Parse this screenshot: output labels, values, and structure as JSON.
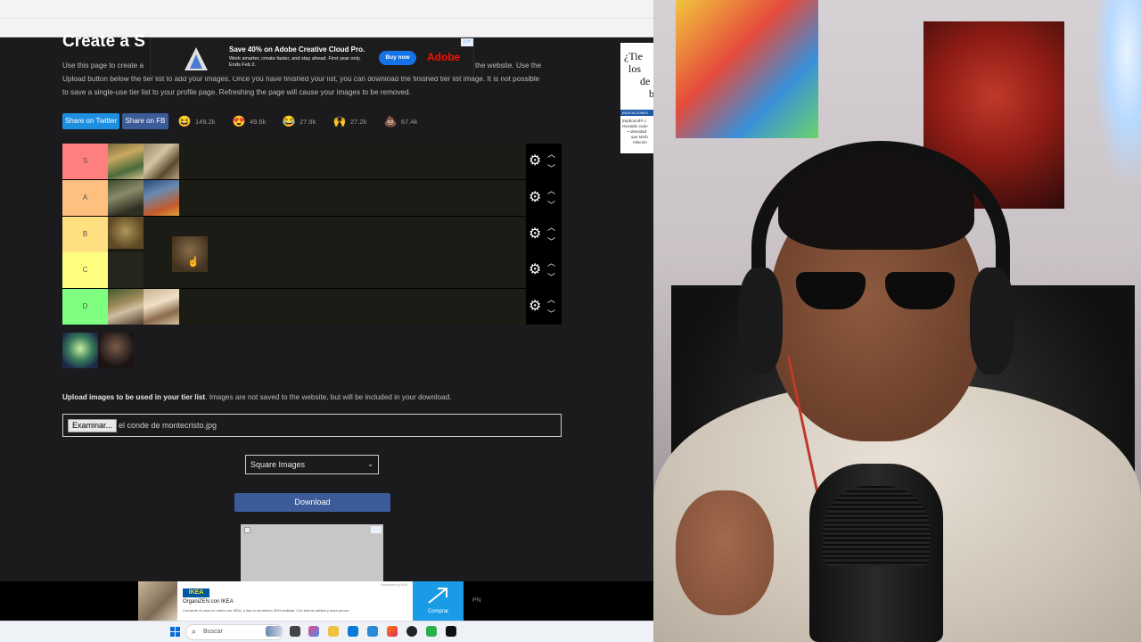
{
  "page": {
    "title": "Create a S",
    "description_lines": [
      "Use this page to create a",
      "Upload button below the tier list to add your images. Once you have finished your list, you can download the finished tier list image. It is not possible",
      "to save a single-use tier list to your profile page. Refreshing the page will cause your images to be removed."
    ],
    "description_line1_tail": "the website. Use the"
  },
  "ad_top": {
    "headline": "Save 40% on Adobe Creative Cloud Pro.",
    "sub": "Work smarter, create faster, and stay ahead. First year only. Ends Feb 2.",
    "button": "Buy now",
    "brand": "Adobe"
  },
  "ad_side": {
    "lines": [
      "¿Tie",
      "los",
      "de",
      "b"
    ],
    "band": "INDICACIONES",
    "small": [
      "Zepbound® c",
      "recetado cuan",
      "• obesidad",
      "que tamb",
      "relacion"
    ]
  },
  "share": {
    "twitter": "Share on Twitter",
    "facebook": "Share on FB"
  },
  "reactions": [
    {
      "icon": "laughing-emoji-icon",
      "glyph": "😆",
      "count": "149.2k"
    },
    {
      "icon": "heart-eyes-emoji-icon",
      "glyph": "😍",
      "count": "49.6k"
    },
    {
      "icon": "tears-of-joy-emoji-icon",
      "glyph": "😂",
      "count": "27.9k"
    },
    {
      "icon": "raised-hands-emoji-icon",
      "glyph": "🙌",
      "count": "27.2k"
    },
    {
      "icon": "poop-emoji-icon",
      "glyph": "💩",
      "count": "67.4k"
    }
  ],
  "tiers": [
    {
      "label": "S",
      "color": "#ff7f7f",
      "images": 2
    },
    {
      "label": "A",
      "color": "#ffbf7f",
      "images": 2
    },
    {
      "label": "B",
      "color": "#ffdf7f",
      "images": 1
    },
    {
      "label": "C",
      "color": "#ffff7f",
      "images": 1
    },
    {
      "label": "D",
      "color": "#7fff7f",
      "images": 2
    }
  ],
  "upload": {
    "bold": "Upload images to be used in your tier list",
    "rest": ". Images are not saved to the website, but will be included in your download."
  },
  "file_input": {
    "button": "Examinar...",
    "filename": "el conde de montecristo.jpg"
  },
  "image_mode": {
    "selected": "Square Images"
  },
  "download_label": "Download",
  "ad_bottom": {
    "brand": "IKEA",
    "title": "OrganiZEN con IKEA",
    "desc": "Convierte el caos en orden con IKEA, y haz tu dormitorio ZEN realidad. Con buena calidad y buen precio.",
    "tag": "Sponsored by IKEA",
    "cta": "Comprar"
  },
  "pn_label": "PN",
  "taskbar": {
    "search_placeholder": "Buscar"
  }
}
